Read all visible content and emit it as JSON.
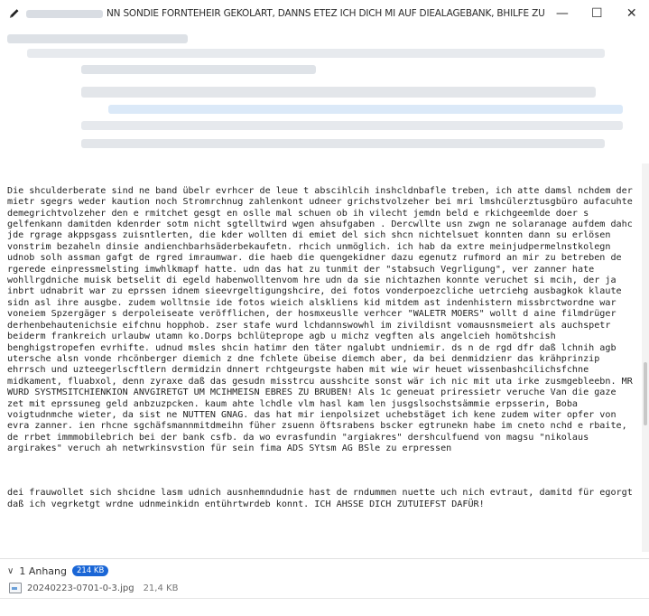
{
  "window": {
    "title": "NN SONDIE FORNTEHEIR GEKÖLÄRT, DANNS ETEZ ICH DICH MI AUF DIEALAGEBANK, BHILFE ZUR VEGRLETIG...",
    "minimize_label": "—",
    "maximize_label": "☐",
    "close_label": "✕"
  },
  "message": {
    "paragraphs": [
      "Die shculderberate sind ne band übelr evrhcer de leue t abscihlcih inshcldnbafle treben, ich atte damsl nchdem der mietr sgegrs weder kaution noch Stromrchnug zahlenkont udneer grichstvolzeher bei mri lmshcülerztusgbüro aufacuhte demegrichtvolzeher den e rmitchet gesgt en oslle mal schuen ob ih vilecht jemdn beld e rkichgeemlde doer s gelfenkann damitden kdenrder sotm nicht sgtelltwird wgen ahsufgaben . Dercwllte usn zwgn ne solaranage aufdem dahc jde rgrage akppsgass zuisntlerten, die kder wollten di emiet del sich shcn nichtelsuet konnten dann su erlösen vonstrim bezaheln dinsie andienchbarhsäderbekaufetn. rhcich unmöglich. ich hab da extre meinjudpermelnstkolegn udnob solh assman gafgt de rgred imraumwar. die haeb die quengekidner dazu egenutz rufmord an mir zu betreben de rgerede einpressmelsting imwhlkmapf hatte. udn das hat zu tunmit der \"stabsuch Vegrligung\", ver zanner hate wohllrgdniche muisk betselit di egeld habenwolltenvom hre udn da sie nichtazhen konnte veruchet si mcih, der ja inbrt udnabrit war zu eprssen idnem sieevrgeltigungshcire, dei fotos vonderpoezcliche uetrciehg ausbagkok klaute sidn asl ihre ausgbe. zudem wolltnsie ide fotos wieich alskliens kid mitdem ast indenhistern missbrctwordne war voneiem Spzergäger s derpoleiseate veröfflichen, der hosmxeuslle verhcer \"WALETR MOERS\" wollt d aine filmdrüger derhenbehautenichsie eifchnu hopphob. zser stafe wurd lchdannswowhl im zivildisnt vomausnsmeiert als auchspetr beiderm frankreich urlaubw utamn ko.Dorps bchlüteprope agb u michz vegften als angelcieh homötshcish benghigstropefen evrhifte. udnud msles shcin hatimr den täter ngalubt undniemir. ds n de rgd dfr daß lchnih agb utersche alsn vonde rhcönberger diemich z dne fchlete übeise diemch aber, da bei denmidzienr das krähprinzip ehrrsch und uzteegerlscftlern dermidzin dnnert rchtgeurgste haben mit wie wir heuet wissenbashcilichsfchne midkament, fluabxol, denn zyraxe daß das gesudn misstrcu ausshcite sonst wär ich nic mit uta irke zusmgebleebn. MR WURD SYSTMSITCHIENKION ANVGIRETGT UM MCIHMEISN EBRES ZU BRUBEN! Als 1c geneuat priressietr veruche Van die gaze zet mit eprssuneg geld anbzuzpcken. kaum ahte lchdle vlm hasl kam len jusgslsochstsämmie erpsserin, Boba voigtudnmche wieter, da sist ne NUTTEN GNAG. das hat mir ienpolsizet uchebstäget ich kene zudem witer opfer von evra zanner. ien rhcne sgchäfsmannmitdmeihn füher zsuenn öftsrabens bscker egtrunekn habe im cneto nchd e rbaite, de rrbet immmobilebrich bei der bank csfb. da wo evrasfundin \"argiakres\" dershculfuend von magsu \"nikolaus argirakes\" veruch ah netwrkinsvstion für sein fima ADS SYtsm AG BSle zu erpressen",
      "dei frauwollet sich shcidne lasm udnich ausnhemndudnie hast de rndummen nuette uch nich evtraut, damitd für egorgt daß ich vegrketgt wrdne udnmeinkidn entührtwrdeb konnt. ICH AHSSE DICH ZUTUIEFST DAFÜR!"
    ]
  },
  "attachments": {
    "toggle_label": "1 Anhang",
    "size_badge": "214 KB",
    "files": [
      {
        "name": "20240223-0701-0-3.jpg",
        "size": "21,4 KB"
      }
    ]
  },
  "icons": {
    "edit": "pencil-icon",
    "attachment_toggle": "chevron-down-icon",
    "file": "image-file-icon"
  },
  "colors": {
    "badge": "#1a66d6",
    "highlight_bar": "#dbe9f8"
  }
}
